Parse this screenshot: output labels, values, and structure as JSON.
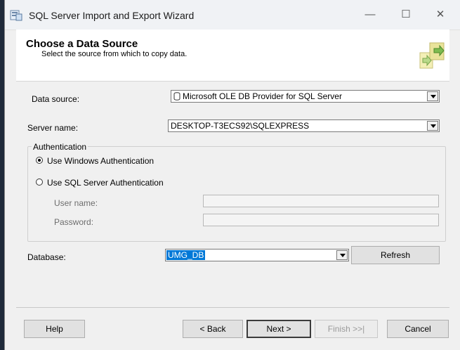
{
  "window": {
    "title": "SQL Server Import and Export Wizard",
    "controls": {
      "minimize": "—",
      "maximize": "☐",
      "close": "✕"
    }
  },
  "header": {
    "title": "Choose a Data Source",
    "subtitle": "Select the source from which to copy data."
  },
  "form": {
    "data_source_label": "Data source:",
    "data_source_value": "Microsoft OLE DB Provider for SQL Server",
    "server_name_label": "Server name:",
    "server_name_value": "DESKTOP-T3ECS92\\SQLEXPRESS",
    "authentication": {
      "legend": "Authentication",
      "windows_auth": "Use Windows Authentication",
      "sql_auth": "Use SQL Server Authentication",
      "selected": "windows",
      "username_label": "User name:",
      "password_label": "Password:",
      "username_value": "",
      "password_value": ""
    },
    "database_label": "Database:",
    "database_value": "UMG_DB",
    "refresh_label": "Refresh"
  },
  "footer": {
    "help": "Help",
    "back": "< Back",
    "next": "Next >",
    "finish": "Finish >>|",
    "cancel": "Cancel"
  },
  "icons": {
    "app": "sql-server-wizard-icon",
    "header_graphic": "wizard-banner-icon",
    "provider": "database-icon"
  }
}
